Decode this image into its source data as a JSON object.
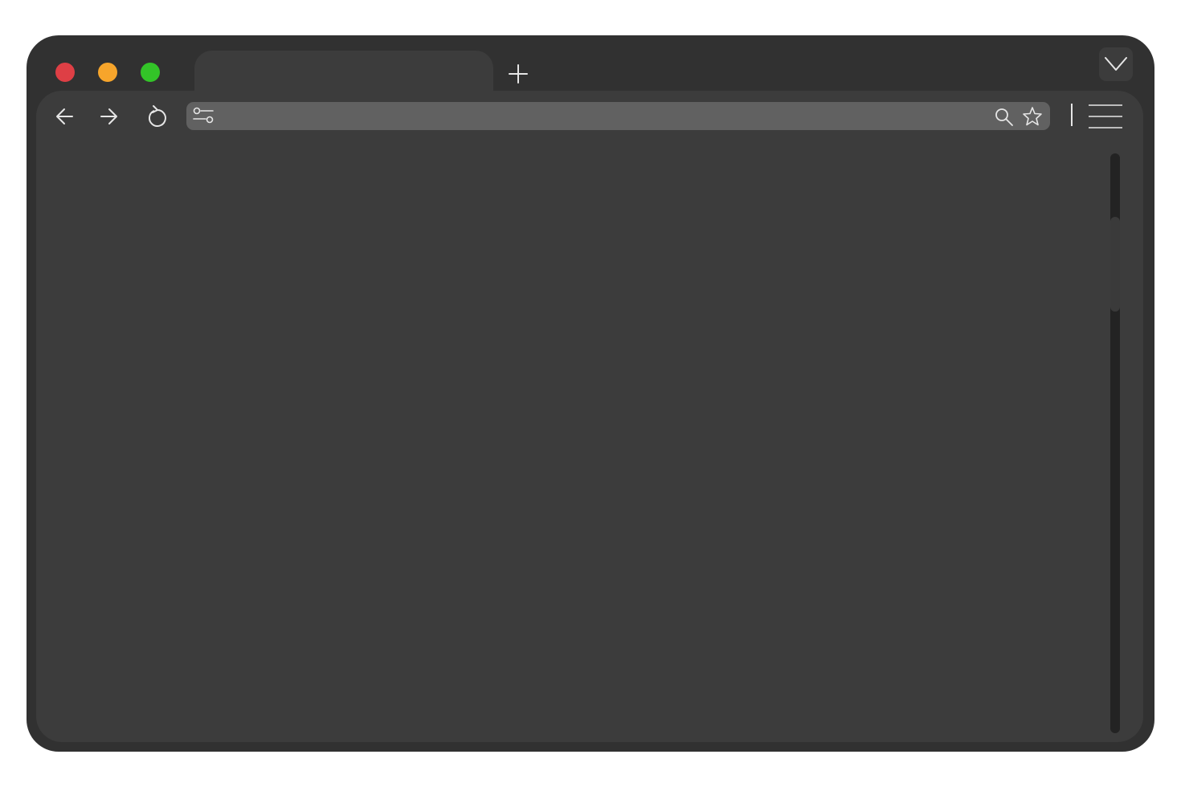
{
  "window": {
    "controls": {
      "close_color": "#de3f45",
      "minimize_color": "#f7a52b",
      "maximize_color": "#33c428"
    },
    "frame_color": "#313131",
    "content_color": "#3c3c3c"
  },
  "tabs": [
    {
      "title": "",
      "active": true
    }
  ],
  "tab_bar": {
    "new_tab_icon": "plus-icon",
    "tab_list_icon": "chevron-down-icon"
  },
  "toolbar": {
    "back_icon": "arrow-left-icon",
    "forward_icon": "arrow-right-icon",
    "reload_icon": "reload-icon",
    "menu_icon": "hamburger-menu-icon"
  },
  "address_bar": {
    "value": "",
    "placeholder": "",
    "color": "#616161",
    "left_icon": "site-settings-icon",
    "right_icons": [
      "search-icon",
      "star-icon"
    ]
  },
  "page": {
    "content": ""
  },
  "scrollbar": {
    "position": 0.13
  }
}
